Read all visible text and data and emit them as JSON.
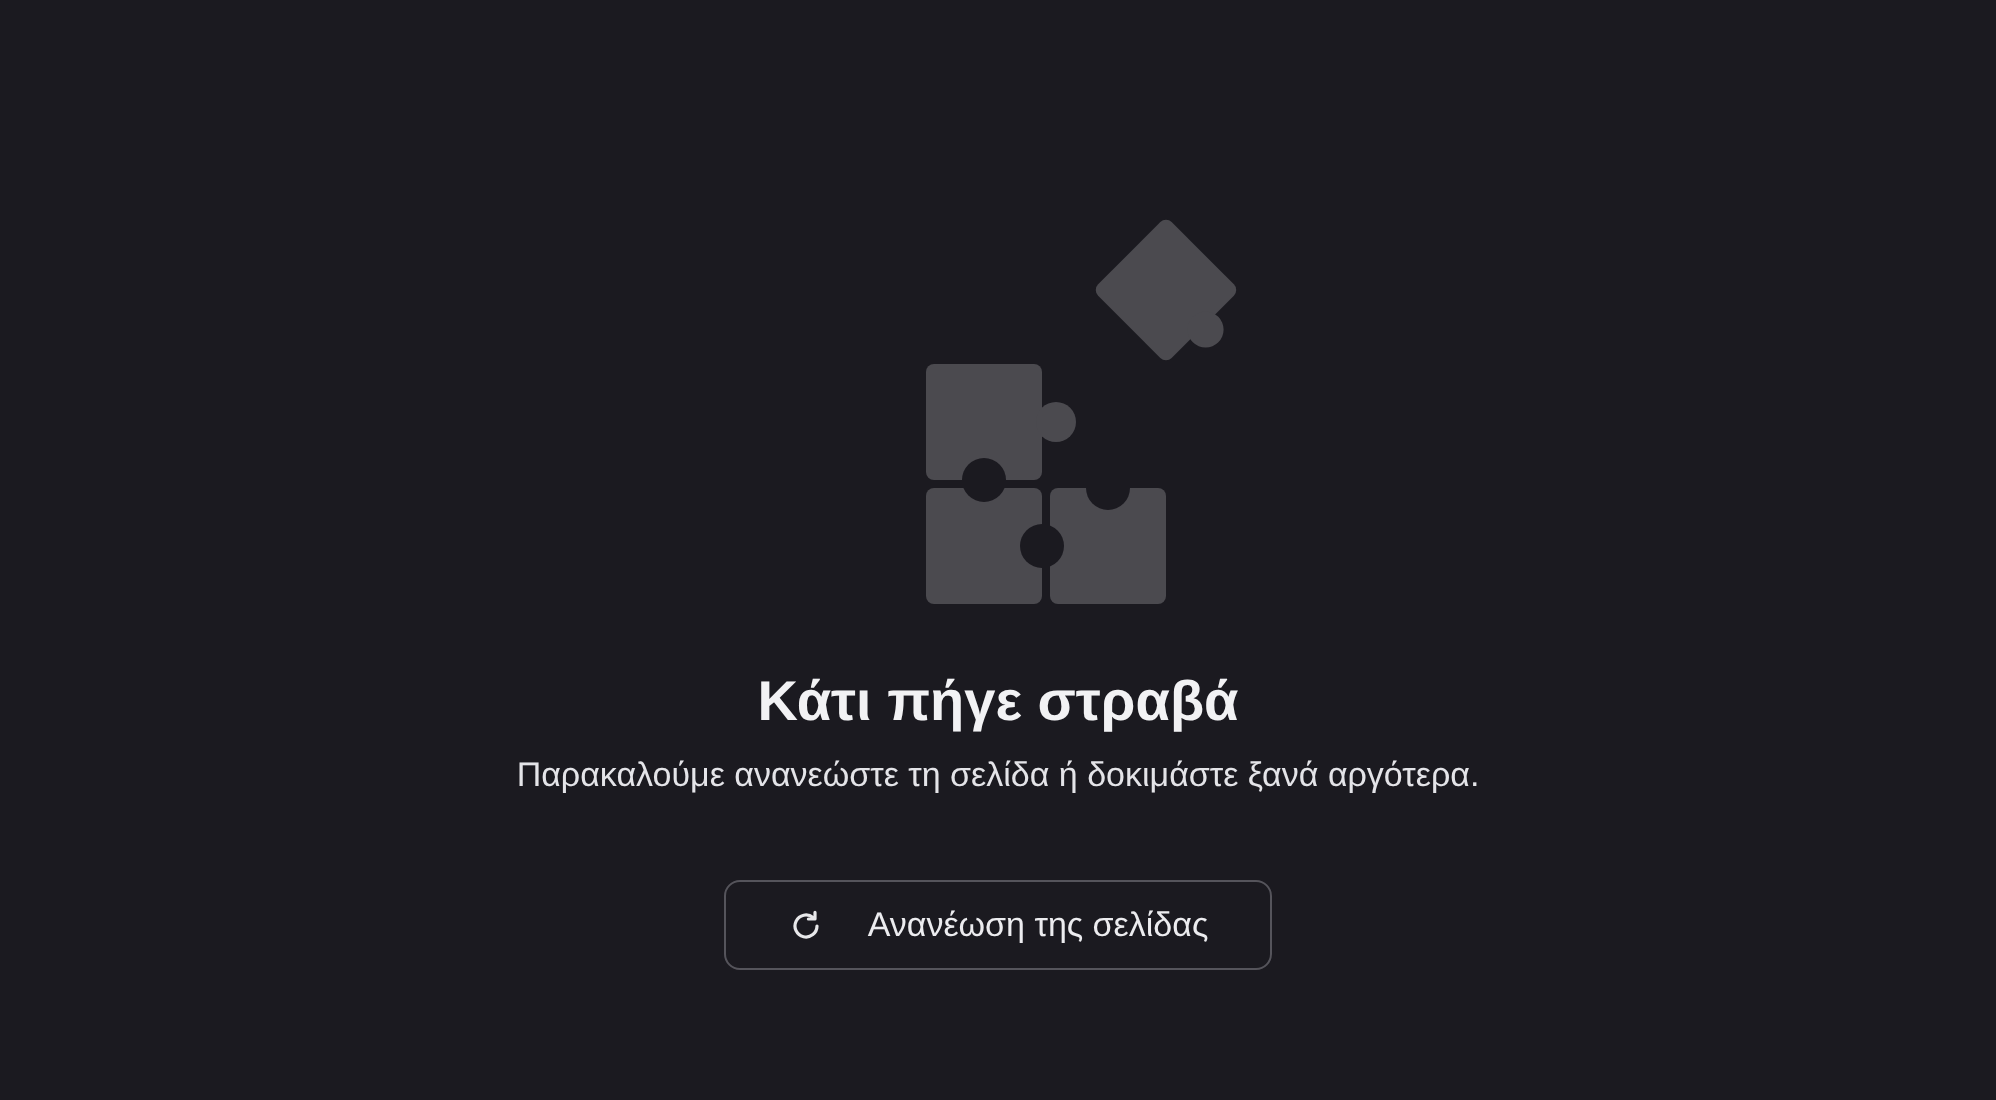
{
  "error": {
    "title": "Κάτι πήγε στραβά",
    "message": "Παρακαλούμε ανανεώστε τη σελίδα ή δοκιμάστε ξανά αργότερα.",
    "button": "Ανανέωση της σελίδας"
  }
}
